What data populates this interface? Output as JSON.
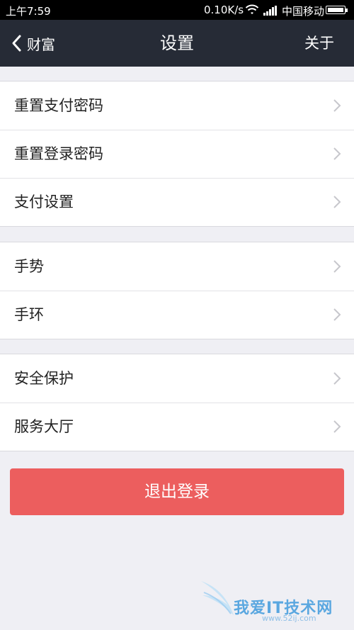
{
  "status_bar": {
    "time": "上午7:59",
    "speed": "0.10K/s",
    "carrier": "中国移动",
    "icons": [
      "wifi-icon",
      "signal-icon",
      "battery-icon"
    ]
  },
  "nav": {
    "back_label": "财富",
    "title": "设置",
    "about_label": "关于",
    "background": "#262b36"
  },
  "groups": [
    {
      "items": [
        {
          "label": "重置支付密码"
        },
        {
          "label": "重置登录密码"
        },
        {
          "label": "支付设置"
        }
      ]
    },
    {
      "items": [
        {
          "label": "手势"
        },
        {
          "label": "手环"
        }
      ]
    },
    {
      "items": [
        {
          "label": "安全保护"
        },
        {
          "label": "服务大厅"
        }
      ]
    }
  ],
  "logout": {
    "label": "退出登录",
    "color": "#ec5e5e"
  },
  "watermark": {
    "text": "我爱IT技术网",
    "sub": "www.52ij.com"
  }
}
